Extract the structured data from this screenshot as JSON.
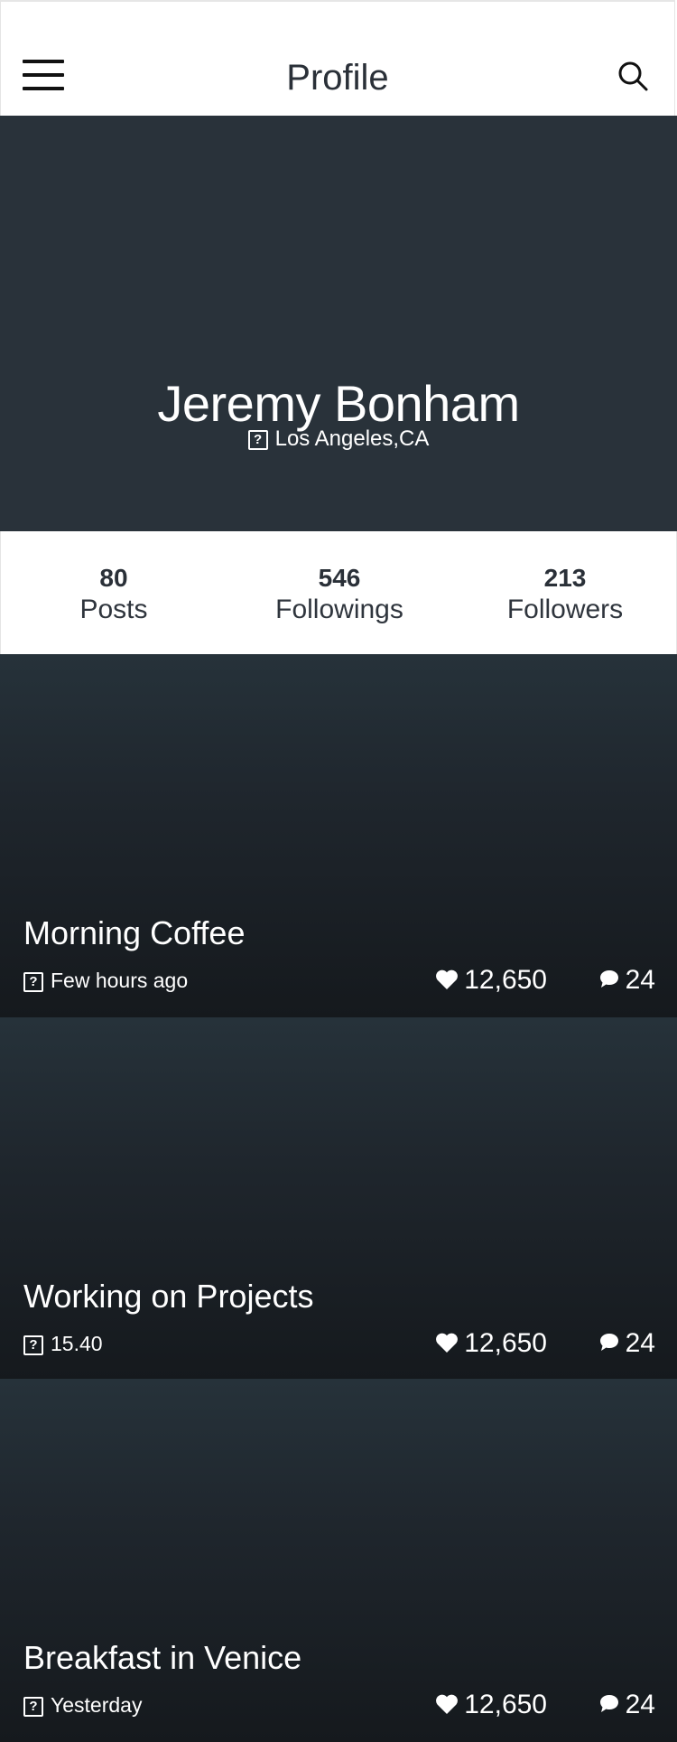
{
  "header": {
    "title": "Profile",
    "menu_icon": "hamburger-menu-icon",
    "search_icon": "search-icon"
  },
  "profile": {
    "name": "Jeremy Bonham",
    "location": "Los Angeles,CA",
    "location_icon": "missing-image-icon"
  },
  "stats": [
    {
      "value": "80",
      "label": "Posts"
    },
    {
      "value": "546",
      "label": "Followings"
    },
    {
      "value": "213",
      "label": "Followers"
    }
  ],
  "posts": [
    {
      "title": "Morning Coffee",
      "time": "Few hours ago",
      "likes": "12,650",
      "comments": "24"
    },
    {
      "title": "Working on Projects",
      "time": "15.40",
      "likes": "12,650",
      "comments": "24"
    },
    {
      "title": "Breakfast in Venice",
      "time": "Yesterday",
      "likes": "12,650",
      "comments": "24"
    }
  ],
  "colors": {
    "hero_bg": "#29323a",
    "text_dark": "#2a3038",
    "white": "#ffffff"
  }
}
